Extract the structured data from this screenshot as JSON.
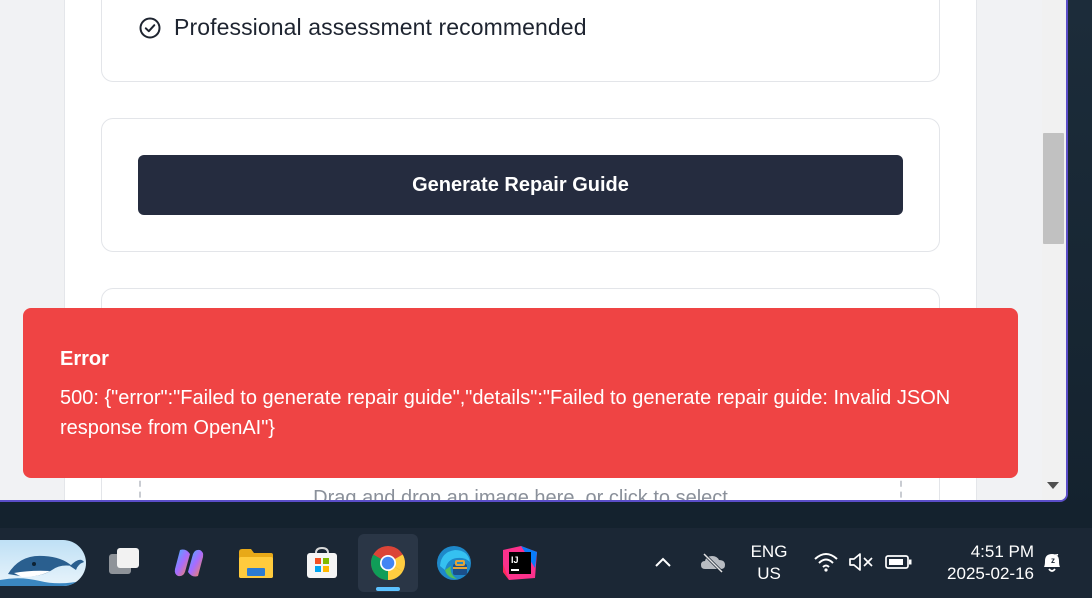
{
  "page": {
    "assessment_item": "Professional assessment recommended",
    "generate_button": "Generate Repair Guide",
    "dropzone_text": "Drag and drop an image here, or click to select"
  },
  "error_toast": {
    "title": "Error",
    "message": "500: {\"error\":\"Failed to generate repair guide\",\"details\":\"Failed to generate repair guide: Invalid JSON response from OpenAI\"}",
    "color": "#ef4444"
  },
  "taskbar": {
    "apps": [
      "widgets",
      "task-view",
      "copilot",
      "file-explorer",
      "microsoft-store",
      "chrome",
      "edge",
      "intellij-idea"
    ],
    "active_app": "chrome",
    "language_line1": "ENG",
    "language_line2": "US",
    "time": "4:51 PM",
    "date": "2025-02-16"
  },
  "colors": {
    "button": "#252c3f",
    "error": "#ef4444",
    "window_border": "#5b4ec8",
    "active_indicator": "#5cc2ff"
  }
}
